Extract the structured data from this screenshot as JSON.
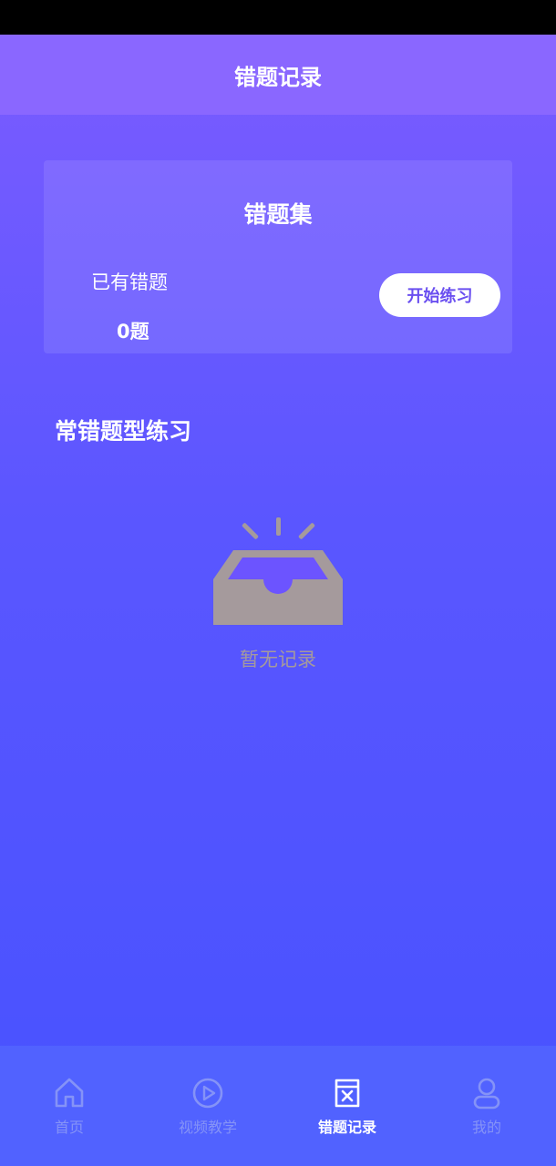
{
  "header": {
    "title": "错题记录"
  },
  "wrong_card": {
    "title": "错题集",
    "count_label": "已有错题",
    "count_value": "0题",
    "start_button": "开始练习"
  },
  "section": {
    "title": "常错题型练习"
  },
  "empty_state": {
    "icon": "empty-inbox-icon",
    "text": "暂无记录"
  },
  "tab_bar": {
    "items": [
      {
        "label": "首页",
        "icon": "home-icon",
        "active": false
      },
      {
        "label": "视频教学",
        "icon": "play-icon",
        "active": false
      },
      {
        "label": "错题记录",
        "icon": "wrong-record-icon",
        "active": true
      },
      {
        "label": "我的",
        "icon": "profile-icon",
        "active": false
      }
    ]
  },
  "colors": {
    "accent": "#6a4ff0",
    "inactive_tab": "#8593f7",
    "empty_icon": "#a59a9c"
  }
}
